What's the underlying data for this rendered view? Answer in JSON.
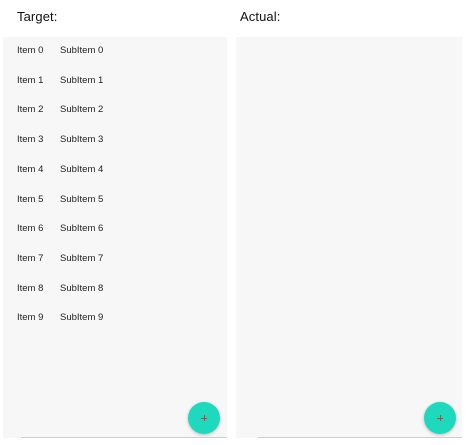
{
  "left_pane": {
    "title": "Target:",
    "items": [
      {
        "item": "Item 0",
        "subitem": "SubItem 0"
      },
      {
        "item": "Item 1",
        "subitem": "SubItem 1"
      },
      {
        "item": "Item 2",
        "subitem": "SubItem 2"
      },
      {
        "item": "Item 3",
        "subitem": "SubItem 3"
      },
      {
        "item": "Item 4",
        "subitem": "SubItem 4"
      },
      {
        "item": "Item 5",
        "subitem": "SubItem 5"
      },
      {
        "item": "Item 6",
        "subitem": "SubItem 6"
      },
      {
        "item": "Item 7",
        "subitem": "SubItem 7"
      },
      {
        "item": "Item 8",
        "subitem": "SubItem 8"
      },
      {
        "item": "Item 9",
        "subitem": "SubItem 9"
      }
    ],
    "fab_icon": "plus-icon",
    "fab_color": "#1ED9BD",
    "fab_icon_color": "#E83030",
    "background": "#F7F7F7"
  },
  "right_pane": {
    "title": "Actual:",
    "items": [],
    "fab_icon": "plus-icon",
    "fab_color": "#1ED9BD",
    "fab_icon_color": "#E83030",
    "background": "#F7F7F7"
  }
}
